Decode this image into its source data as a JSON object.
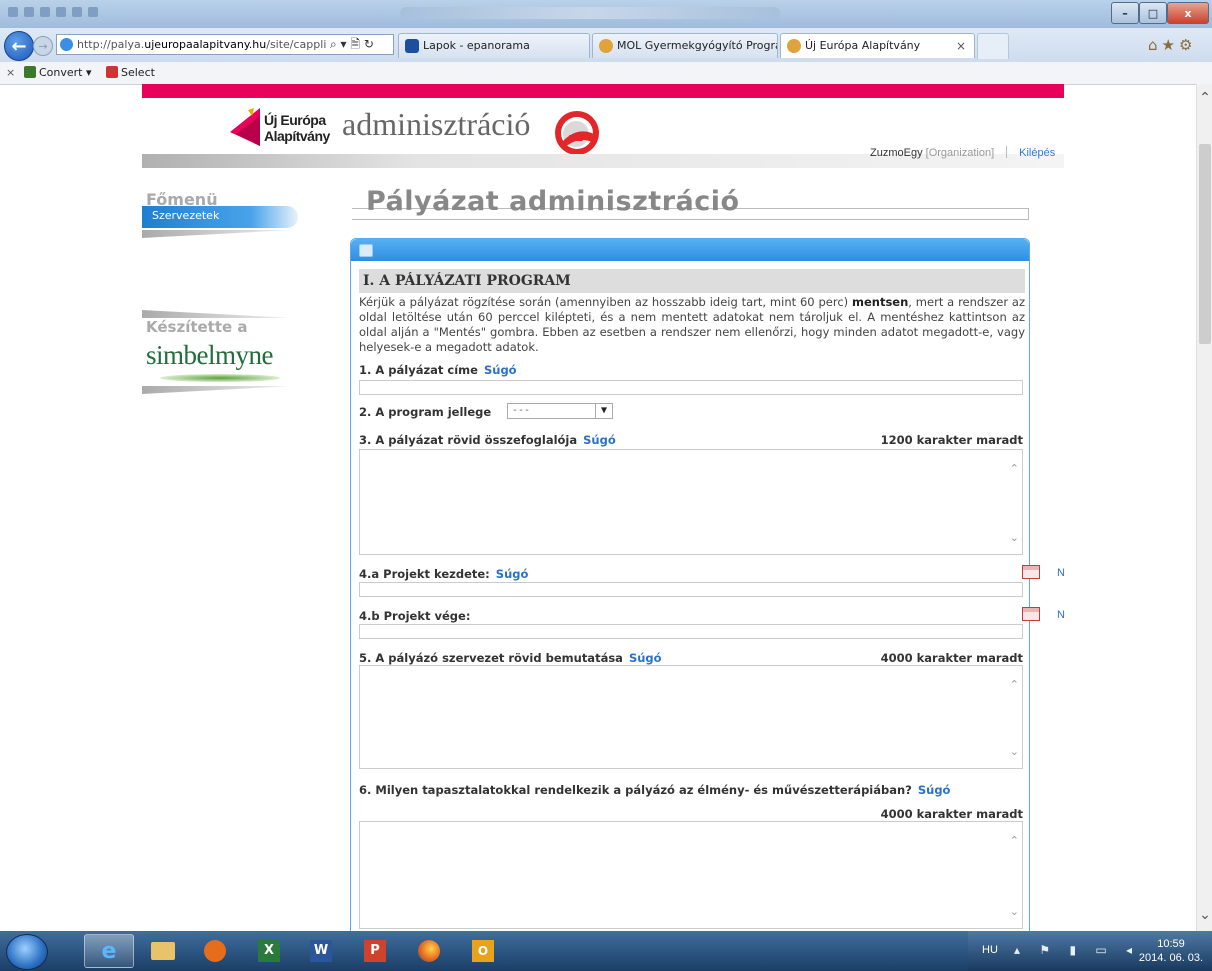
{
  "browser": {
    "url_prefix": "http://palya.",
    "url_domain": "ujeuropaalapitvany.hu",
    "url_path": "/site/cappli",
    "address_icons": "⌕ ▾ 🗎 ↻",
    "tabs": [
      {
        "label": "Lapok - epanorama"
      },
      {
        "label": "MOL Gyermekgyógyító Program"
      },
      {
        "label": "Új Európa Alapítvány",
        "close": "×"
      }
    ],
    "right_icons": "⌂★⚙",
    "min_label": "–",
    "max_label": "□",
    "close_label": "x"
  },
  "command_bar": {
    "close": "×",
    "convert_label": "Convert ▾",
    "select_label": "Select"
  },
  "header": {
    "logo_line1": "Új Európa",
    "logo_line2": "Alapítvány",
    "admin_title": "adminisztráció",
    "user_name": "ZuzmoEgy",
    "user_role": "[Organization]",
    "logout": "Kilépés"
  },
  "sidebar": {
    "menu_title": "Főmenü",
    "items": [
      {
        "label": "Szervezetek"
      }
    ],
    "made_by_label": "Készítette a",
    "made_by_brand": "simbelmyne"
  },
  "main": {
    "page_title": "Pályázat adminisztráció",
    "section_title": "I. A PÁLYÁZATI PROGRAM",
    "intro_part1": "Kérjük a pályázat rögzítése során (amennyiben az hosszabb ideig tart, mint 60 perc) ",
    "intro_bold": "mentsen",
    "intro_part2": ", mert a rendszer az oldal letöltése után 60 perccel kilépteti, és a nem mentett adatokat nem tároljuk el. A mentéshez kattintson az oldal alján a \"Mentés\" gombra. Ebben az esetben a rendszer nem ellenőrzi, hogy minden adatot megadott-e, vagy helyesek-e a megadott adatok.",
    "help": "Súgó",
    "fields": {
      "title": {
        "label": "1. A pályázat címe"
      },
      "program_type": {
        "label": "2. A program jellege",
        "selected": "---"
      },
      "summary": {
        "label": "3. A pályázat rövid összefoglalója",
        "counter": "1200 karakter maradt"
      },
      "project_start": {
        "label": "4.a Projekt kezdete:",
        "n": "N"
      },
      "project_end": {
        "label": "4.b Projekt vége:",
        "n": "N"
      },
      "org_intro": {
        "label": "5. A pályázó szervezet rövid bemutatása",
        "counter": "4000 karakter maradt"
      },
      "experience": {
        "label": "6. Milyen tapasztalatokkal rendelkezik a pályázó az élmény- és művészetterápiában?",
        "counter": "4000 karakter maradt"
      }
    }
  },
  "taskbar": {
    "excel": "X",
    "word": "W",
    "ppt": "P",
    "outlook": "O",
    "lang": "HU",
    "tray_icons": "▴ ⚑ ▮ ▭ ◂",
    "time": "10:59",
    "date": "2014. 06. 03."
  },
  "colors": {
    "brand_pink": "#e8005a",
    "accent_blue": "#2d8ee2",
    "link_blue": "#2a72c7"
  }
}
